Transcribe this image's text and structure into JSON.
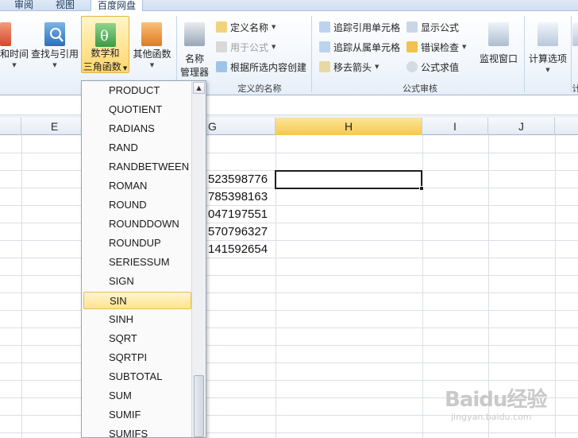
{
  "tabs": [
    "审阅",
    "视图",
    "百度网盘"
  ],
  "ribbon": {
    "datetime_label": "和时间",
    "lookup_label": "查找与引用",
    "math_label_1": "数学和",
    "math_label_2": "三角函数",
    "other_label": "其他函数",
    "name_manager_1": "名称",
    "name_manager_2": "管理器",
    "define_name": "定义名称",
    "use_in_formula": "用于公式",
    "create_from_selection": "根据所选内容创建",
    "defined_names_group": "定义的名称",
    "trace_precedents": "追踪引用单元格",
    "trace_dependents": "追踪从属单元格",
    "remove_arrows": "移去箭头",
    "show_formulas": "显示公式",
    "error_checking": "错误检查",
    "evaluate_formula": "公式求值",
    "watch_window": "监视窗口",
    "formula_auditing_group": "公式审核",
    "calc_options": "计算选项",
    "calc_group_partial": "计"
  },
  "columns": [
    "E",
    "G",
    "H",
    "I",
    "J"
  ],
  "cells": [
    "523598776",
    "785398163",
    "047197551",
    "570796327",
    "141592654"
  ],
  "functions": [
    "PRODUCT",
    "QUOTIENT",
    "RADIANS",
    "RAND",
    "RANDBETWEEN",
    "ROMAN",
    "ROUND",
    "ROUNDDOWN",
    "ROUNDUP",
    "SERIESSUM",
    "SIGN",
    "SIN",
    "SINH",
    "SQRT",
    "SQRTPI",
    "SUBTOTAL",
    "SUM",
    "SUMIF",
    "SUMIFS"
  ],
  "highlighted_function": "SIN",
  "watermark": {
    "text": "Baidu经验",
    "url": "jingyan.baidu.com"
  }
}
